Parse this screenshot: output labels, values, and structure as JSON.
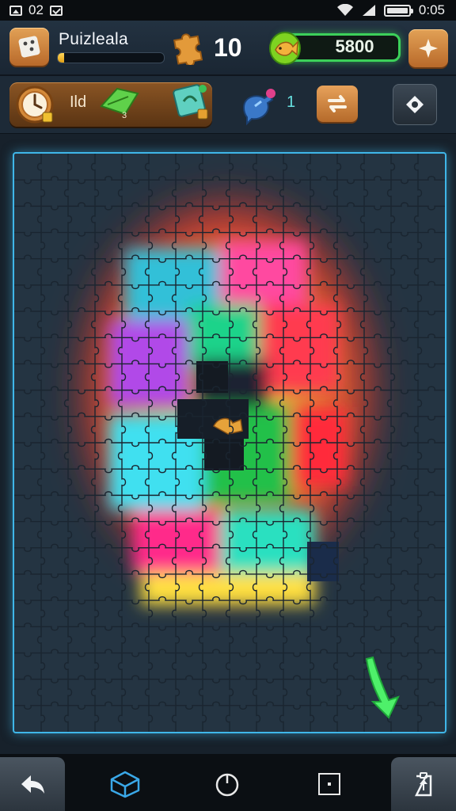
{
  "status_bar": {
    "left_text": "02",
    "time": "0:05",
    "icons": [
      "image-icon",
      "message-icon",
      "wifi-icon",
      "signal-icon",
      "battery-icon"
    ]
  },
  "header": {
    "app_icon": "dice-icon",
    "title": "Puizleala",
    "xp_progress": 0.06,
    "pieces_icon": "puzzle-piece-icon",
    "pieces": "10",
    "coin_icon": "coin-fish-icon",
    "coins": "5800",
    "add_icon": "star-icon"
  },
  "toolbar": {
    "boost_label": "Ild",
    "boost_count": "3",
    "clock_icon": "clock-icon",
    "leaf_icon": "leaf-icon",
    "gem_icon": "gem-icon",
    "hint_icon": "hint-potion-icon",
    "hint_count": "1",
    "swap_icon": "swap-icon",
    "settings_icon": "diamond-icon"
  },
  "board": {
    "grid_cols": 16,
    "grid_rows": 22,
    "accent": "#3fb6e8",
    "arrow_icon": "green-arrow-icon"
  },
  "navbar": {
    "items": [
      "back-icon",
      "cube-icon",
      "power-icon",
      "square-icon",
      "share-icon"
    ]
  }
}
